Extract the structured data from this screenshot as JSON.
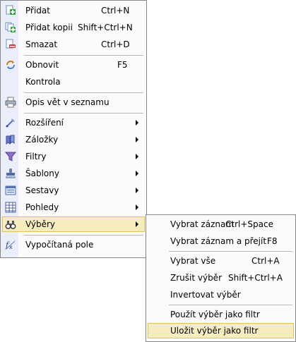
{
  "main_menu": {
    "items": [
      {
        "label": "Přidat",
        "shortcut": "Ctrl+N",
        "icon": "add-icon"
      },
      {
        "label": "Přidat kopii",
        "shortcut": "Shift+Ctrl+N",
        "icon": "add-copy-icon"
      },
      {
        "label": "Smazat",
        "shortcut": "Ctrl+D",
        "icon": "delete-icon"
      },
      {
        "label": "Obnovit",
        "shortcut": "F5",
        "icon": "refresh-icon"
      },
      {
        "label": "Kontrola",
        "shortcut": "",
        "icon": ""
      },
      {
        "label": "Opis vět v seznamu",
        "shortcut": "",
        "icon": "print-list-icon"
      },
      {
        "label": "Rozšíření",
        "icon": "extension-icon"
      },
      {
        "label": "Záložky",
        "icon": "bookmarks-icon"
      },
      {
        "label": "Filtry",
        "icon": "filter-icon"
      },
      {
        "label": "Šablony",
        "icon": "stamp-icon"
      },
      {
        "label": "Sestavy",
        "icon": "report-icon"
      },
      {
        "label": "Pohledy",
        "icon": "grid-view-icon"
      },
      {
        "label": "Výběry",
        "icon": "binoculars-icon"
      },
      {
        "label": "Vypočítaná pole",
        "icon": "function-icon"
      }
    ]
  },
  "sub_menu": {
    "items": [
      {
        "label": "Vybrat záznam",
        "shortcut": "Ctrl+Space"
      },
      {
        "label": "Vybrat záznam a přejít",
        "shortcut": "F8"
      },
      {
        "label": "Vybrat vše",
        "shortcut": "Ctrl+A"
      },
      {
        "label": "Zrušit výběr",
        "shortcut": "Shift+Ctrl+A"
      },
      {
        "label": "Invertovat výběr",
        "shortcut": ""
      },
      {
        "label": "Použít výběr jako filtr",
        "shortcut": ""
      },
      {
        "label": "Uložit výběr jako filtr",
        "shortcut": ""
      }
    ]
  }
}
